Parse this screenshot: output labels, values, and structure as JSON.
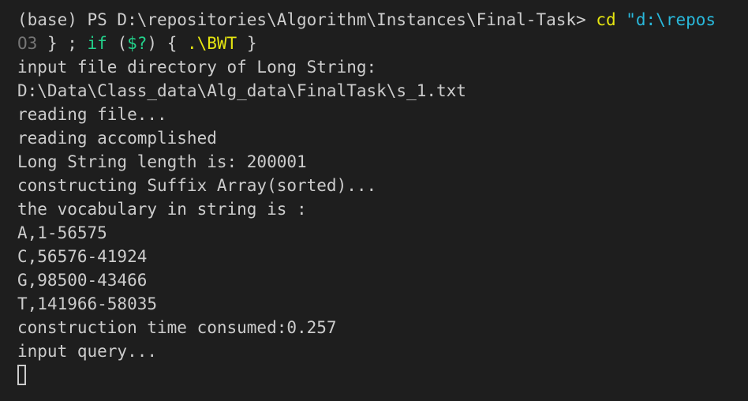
{
  "terminal": {
    "prompt": {
      "prefix": "(base) PS D:\\repositories\\Algorithm\\Instances\\Final-Task> ",
      "command": "cd",
      "arg": " \"d:\\repos"
    },
    "continuation": {
      "dim": "O3",
      "rest1": " } ; ",
      "if_kw": "if",
      "rest2": " (",
      "var": "$?",
      "rest3": ") { ",
      "exe": ".\\BWT",
      "rest4": " }"
    },
    "output_lines": [
      "input file directory of Long String:",
      "D:\\Data\\Class_data\\Alg_data\\FinalTask\\s_1.txt",
      "reading file...",
      "reading accomplished",
      "Long String length is: 200001",
      "constructing Suffix Array(sorted)...",
      "the vocabulary in string is :",
      "A,1-56575",
      "C,56576-41924",
      "G,98500-43466",
      "T,141966-58035",
      "construction time consumed:0.257",
      "input query..."
    ]
  },
  "colors": {
    "background": "#1e1e1e",
    "foreground": "#cccccc",
    "command": "#e5e510",
    "string": "#29b8db",
    "keyword": "#23d18b"
  }
}
